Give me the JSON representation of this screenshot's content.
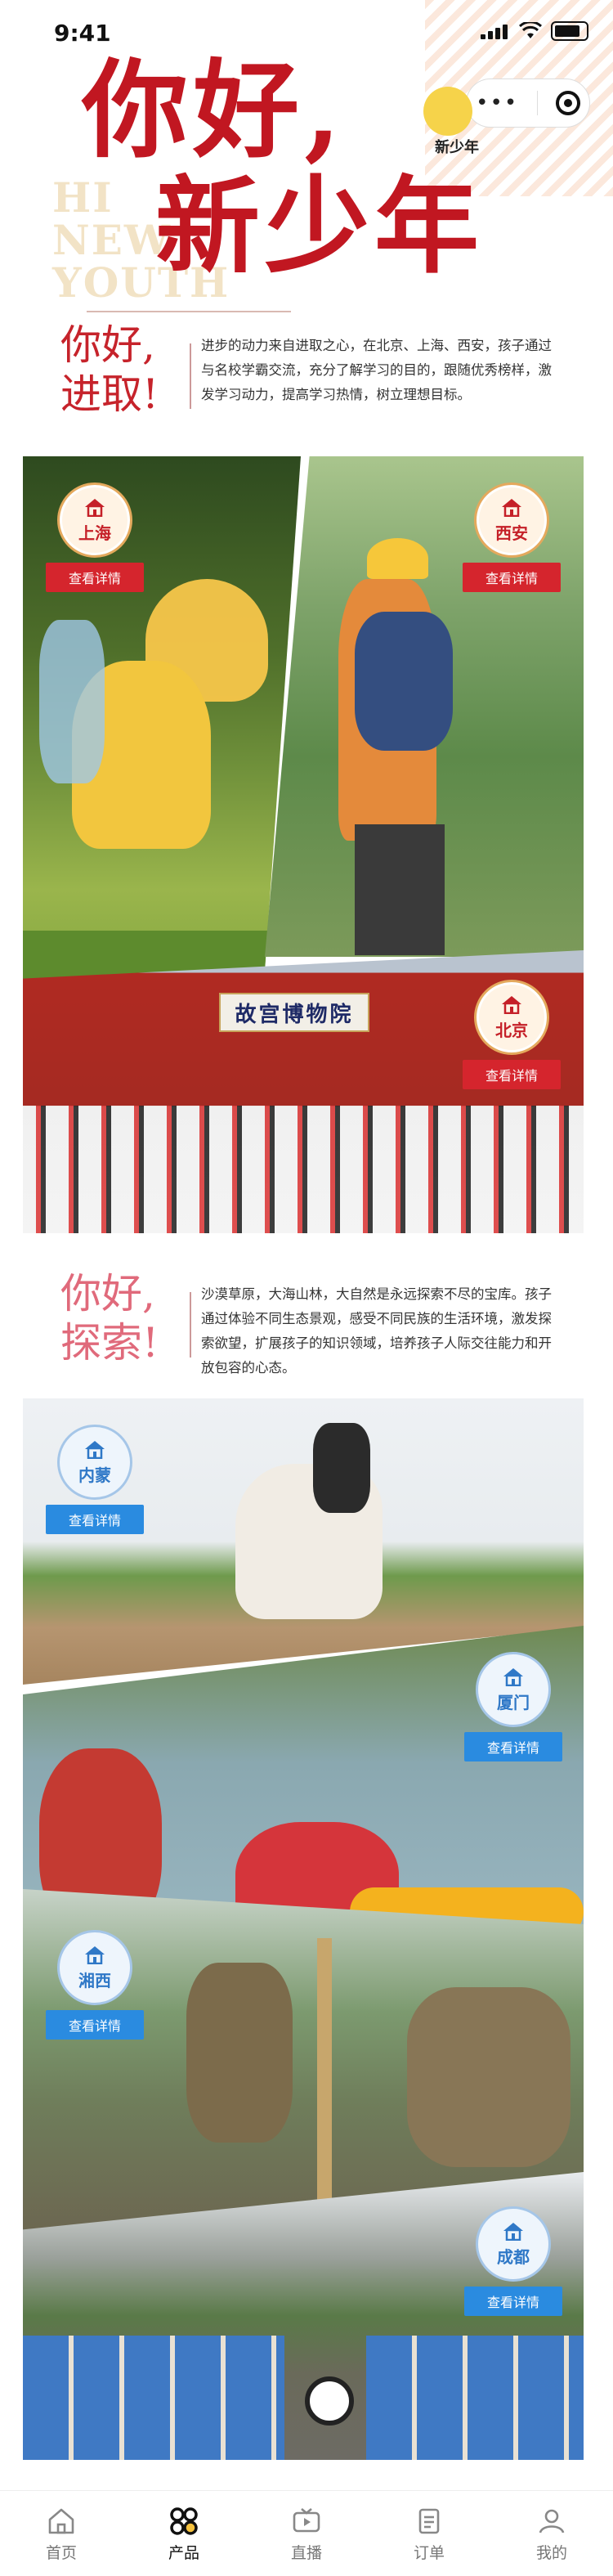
{
  "status_bar": {
    "time": "9:41"
  },
  "hero": {
    "title_line1": "你好,",
    "title_line2": "新少年",
    "ghost_lines": [
      "HI",
      "NEW",
      "YOUTH"
    ],
    "logo_text": "新少年"
  },
  "section1": {
    "heading_line1": "你好,",
    "heading_line2": "进取!",
    "text": "进步的动力来自进取之心，在北京、上海、西安，孩子通过与名校学霸交流，充分了解学习的目的，跟随优秀榜样，激发学习动力，提高学习热情，树立理想目标。"
  },
  "section2": {
    "heading_line1": "你好,",
    "heading_line2": "探索!",
    "text": "沙漠草原，大海山林，大自然是永远探索不尽的宝库。孩子通过体验不同生态景观，感受不同民族的生活环境，激发探索欲望，扩展孩子的知识领域，培养孩子人际交往能力和开放包容的心态。"
  },
  "destinations": [
    {
      "city": "上海",
      "detail": "查看详情"
    },
    {
      "city": "西安",
      "detail": "查看详情"
    },
    {
      "city": "北京",
      "detail": "查看详情"
    },
    {
      "city": "内蒙",
      "detail": "查看详情"
    },
    {
      "city": "厦门",
      "detail": "查看详情"
    },
    {
      "city": "湘西",
      "detail": "查看详情"
    },
    {
      "city": "成都",
      "detail": "查看详情"
    }
  ],
  "tabbar": [
    {
      "label": "首页",
      "icon": "home-icon"
    },
    {
      "label": "产品",
      "icon": "product-grid-icon"
    },
    {
      "label": "直播",
      "icon": "live-tv-icon"
    },
    {
      "label": "订单",
      "icon": "order-icon"
    },
    {
      "label": "我的",
      "icon": "profile-icon"
    }
  ],
  "colors": {
    "brand_red": "#c11721",
    "detail_red": "#d5252d",
    "detail_blue": "#2a8be0"
  }
}
